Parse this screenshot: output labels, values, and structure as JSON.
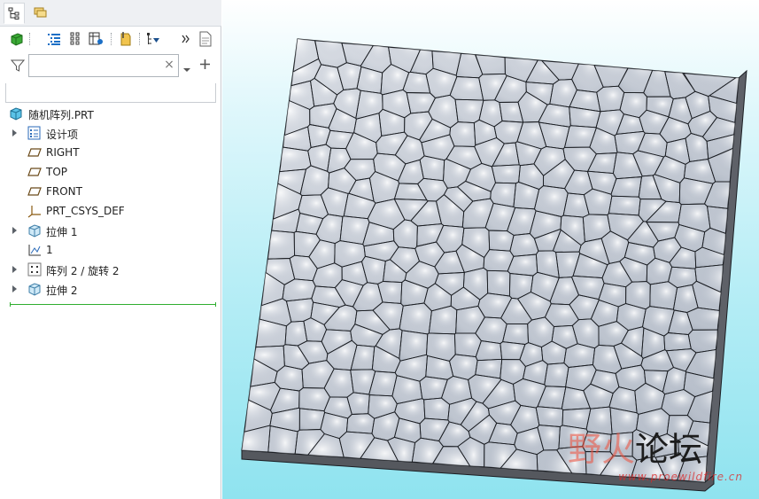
{
  "tabs": [
    {
      "name": "model-tree-tab",
      "icon": "tree-structure-icon"
    },
    {
      "name": "layers-tab",
      "icon": "layers-icon"
    }
  ],
  "toolbar": {
    "buttons": [
      "show-icon",
      "tree-columns-icon",
      "tree-filters-icon",
      "settings-icon",
      "annotation-icon",
      "settings-dropdown-icon",
      "more-icon",
      "details-icon"
    ]
  },
  "filter": {
    "search_value": "",
    "search_placeholder": "",
    "clear_label": "×"
  },
  "tree": {
    "root": {
      "label": "随机阵列.PRT",
      "icon": "part-icon"
    },
    "items": [
      {
        "label": "设计项",
        "icon": "design-items-icon",
        "expandable": true
      },
      {
        "label": "RIGHT",
        "icon": "datum-plane-icon",
        "expandable": false
      },
      {
        "label": "TOP",
        "icon": "datum-plane-icon",
        "expandable": false
      },
      {
        "label": "FRONT",
        "icon": "datum-plane-icon",
        "expandable": false
      },
      {
        "label": "PRT_CSYS_DEF",
        "icon": "csys-icon",
        "expandable": false
      },
      {
        "label": "拉伸 1",
        "icon": "extrude-icon",
        "expandable": true
      },
      {
        "label": "1",
        "icon": "sketch-icon",
        "expandable": false
      },
      {
        "label": "阵列 2 / 旋转 2",
        "icon": "pattern-icon",
        "expandable": true
      },
      {
        "label": "拉伸 2",
        "icon": "extrude-icon",
        "expandable": true
      }
    ]
  },
  "viewport": {
    "background_top": "#ffffff",
    "background_bottom": "#8fe3ef",
    "model_color": "#c9cfd8",
    "edge_color": "#1a1d22"
  },
  "watermark": {
    "left_text": "野火",
    "right_text": "论坛",
    "url": "www.proewildfire.cn"
  }
}
